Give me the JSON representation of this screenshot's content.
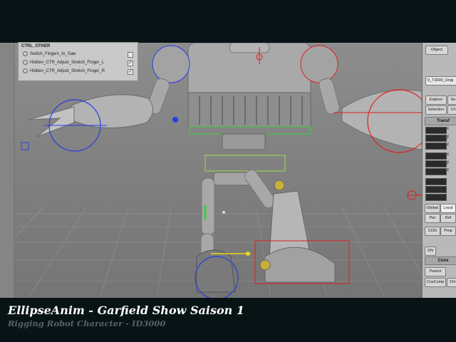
{
  "caption": {
    "title": "EllipseAnim - Garfield Show Saison 1",
    "subtitle": "Rigging Robot Character - ID3000"
  },
  "layer_panel": {
    "header": "CTRL_OTHER",
    "rows": [
      {
        "label": "Switch_Fingers_to_Saw",
        "checked": false
      },
      {
        "label": "Hidden_CTR_Adjust_Stretch_Finger_L",
        "checked": true
      },
      {
        "label": "Hidden_CTR_Adjust_Stretch_Finger_R",
        "checked": true
      }
    ]
  },
  "properties_panel": {
    "tab": "Object",
    "object_name": "0_T3000_Origi",
    "buttons": {
      "explore": "Explore",
      "explore_extra": "Se",
      "selection": "Selection",
      "selection_extra": "Ch",
      "global": "Global",
      "local": "Local",
      "par": "Par",
      "ref": "Ref",
      "cog": "COG",
      "prop": "Prop",
      "on": "ON",
      "parent": "Parent",
      "cnscomp": "CnsComp",
      "chi": "Chi"
    },
    "sections": {
      "transform": "Transf",
      "constrain": "Cons"
    },
    "axes": [
      "x",
      "y",
      "z",
      "x",
      "y",
      "z"
    ]
  },
  "colors": {
    "background": "#071315",
    "viewport": "#8a8a8a",
    "selection_red": "#e02020",
    "selection_blue": "#2a3ee0",
    "selection_green": "#3ad03a",
    "highlight_yellow": "#e6d422",
    "caption_title": "#ffffff",
    "caption_subtitle": "#5b6166"
  }
}
